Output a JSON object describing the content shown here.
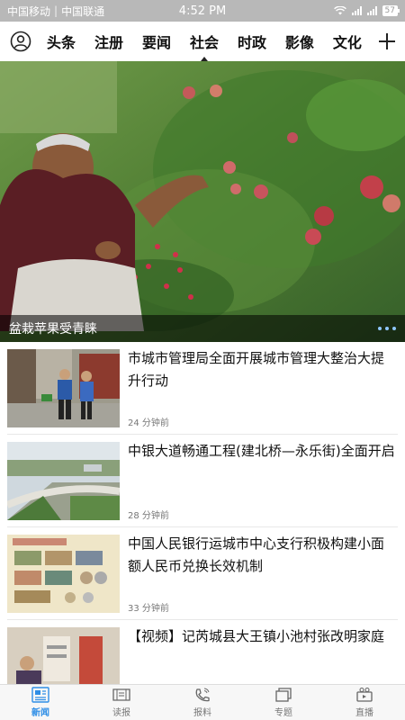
{
  "status_bar": {
    "carrier1": "中国移动",
    "carrier2": "中国联通",
    "time": "4:52 PM",
    "battery": "57"
  },
  "nav": {
    "tabs": [
      {
        "label": "头条"
      },
      {
        "label": "注册"
      },
      {
        "label": "要闻"
      },
      {
        "label": "社会",
        "active": true
      },
      {
        "label": "时政"
      },
      {
        "label": "影像"
      },
      {
        "label": "文化"
      }
    ],
    "icons": {
      "user": "user-circle-icon",
      "add": "plus-icon"
    }
  },
  "hero": {
    "caption": "盆栽苹果受青睐"
  },
  "articles": [
    {
      "title": "市城市管理局全面开展城市管理大整治大提升行动",
      "time": "24 分钟前"
    },
    {
      "title": "中银大道畅通工程(建北桥—永乐街)全面开启",
      "time": "28 分钟前"
    },
    {
      "title": "中国人民银行运城市中心支行积极构建小面额人民币兑换长效机制",
      "time": "33 分钟前"
    },
    {
      "title": "【视频】记芮城县大王镇小池村张改明家庭",
      "time": ""
    }
  ],
  "tabbar": {
    "items": [
      {
        "label": "新闻",
        "icon": "news-icon",
        "active": true
      },
      {
        "label": "读报",
        "icon": "newspaper-icon"
      },
      {
        "label": "报料",
        "icon": "phone-icon"
      },
      {
        "label": "专题",
        "icon": "topics-icon"
      },
      {
        "label": "直播",
        "icon": "live-icon"
      }
    ]
  },
  "colors": {
    "accent": "#2e8ee6",
    "statusbar": "#b8b8b8"
  }
}
